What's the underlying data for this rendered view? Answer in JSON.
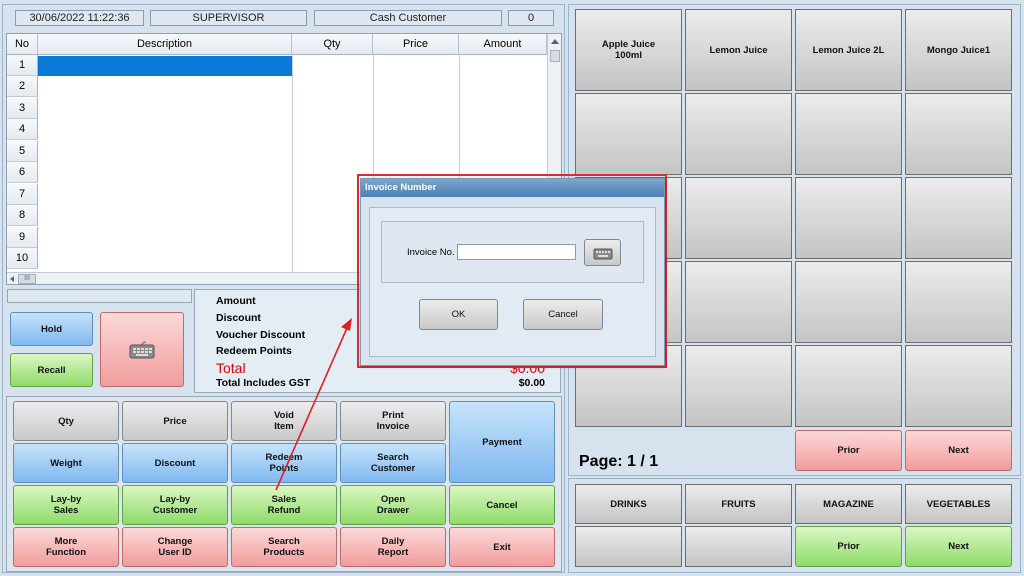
{
  "status_bar": {
    "datetime": "30/06/2022  11:22:36",
    "user": "SUPERVISOR",
    "customer": "Cash Customer",
    "count": "0"
  },
  "grid": {
    "columns": [
      "No",
      "Description",
      "Qty",
      "Price",
      "Amount"
    ],
    "rows": [
      "1",
      "2",
      "3",
      "4",
      "5",
      "6",
      "7",
      "8",
      "9",
      "10"
    ],
    "hscroll_label": "III"
  },
  "side_buttons": {
    "hold": "Hold",
    "recall": "Recall"
  },
  "summary": {
    "amount_label": "Amount",
    "discount_label": "Discount",
    "voucher_discount_label": "Voucher Discount",
    "redeem_points_label": "Redeem Points",
    "total_label": "Total",
    "total_value": "$0.00",
    "gst_label": "Total Includes GST",
    "gst_value": "$0.00"
  },
  "function_buttons": {
    "qty": "Qty",
    "price": "Price",
    "void_item": "Void\nItem",
    "print_invoice": "Print\nInvoice",
    "payment": "Payment",
    "weight": "Weight",
    "discount": "Discount",
    "redeem_points": "Redeem\nPoints",
    "search_customer": "Search\nCustomer",
    "layby_sales": "Lay-by\nSales",
    "layby_customer": "Lay-by\nCustomer",
    "sales_refund": "Sales\nRefund",
    "open_drawer": "Open\nDrawer",
    "cancel": "Cancel",
    "more_function": "More\nFunction",
    "change_user_id": "Change\nUser ID",
    "search_products": "Search\nProducts",
    "daily_report": "Daily\nReport",
    "exit": "Exit"
  },
  "products": [
    "Apple Juice\n100ml",
    "Lemon Juice",
    "Lemon Juice 2L",
    "Mongo Juice1"
  ],
  "product_pager": {
    "page_label": "Page: 1 / 1",
    "prior": "Prior",
    "next": "Next"
  },
  "categories": [
    "DRINKS",
    "FRUITS",
    "MAGAZINE",
    "VEGETABLES"
  ],
  "category_pager": {
    "prior": "Prior",
    "next": "Next"
  },
  "dialog": {
    "title": "Invoice Number",
    "invoice_label": "Invoice No.",
    "invoice_value": "",
    "ok": "OK",
    "cancel": "Cancel"
  },
  "colors": {
    "highlight": "#d62f2f",
    "selection": "#0a78d7"
  }
}
